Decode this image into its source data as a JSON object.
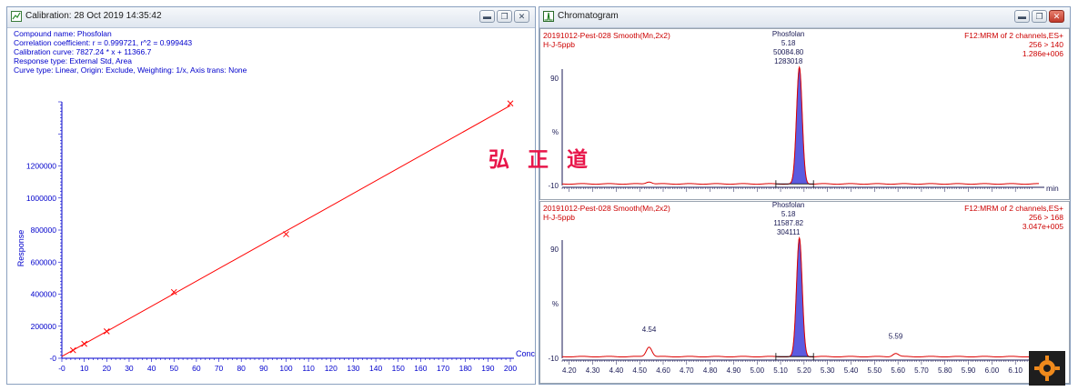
{
  "calibration_window": {
    "title": "Calibration: 28 Oct 2019 14:35:42",
    "info_lines": [
      "Compound name: Phosfolan",
      "Correlation coefficient: r = 0.999721, r^2 = 0.999443",
      "Calibration curve: 7827.24 * x + 11366.7",
      "Response type: External Std, Area",
      "Curve type: Linear, Origin: Exclude, Weighting: 1/x, Axis trans: None"
    ],
    "buttons": [
      "minimize",
      "restore",
      "close"
    ],
    "chart_data": {
      "type": "scatter",
      "xlabel": "Conc",
      "ylabel": "Response",
      "xlim": [
        0,
        200
      ],
      "ylim": [
        0,
        1600000
      ],
      "x_ticks": [
        "-0",
        "10",
        "20",
        "30",
        "40",
        "50",
        "60",
        "70",
        "80",
        "90",
        "100",
        "110",
        "120",
        "130",
        "140",
        "150",
        "160",
        "170",
        "180",
        "190",
        "200"
      ],
      "y_ticks": [
        "-0",
        "200000",
        "400000",
        "600000",
        "800000",
        "1000000",
        "1200000"
      ],
      "points": [
        {
          "x": 5,
          "y": 50000
        },
        {
          "x": 10,
          "y": 90000
        },
        {
          "x": 20,
          "y": 168000
        },
        {
          "x": 50,
          "y": 413000
        },
        {
          "x": 100,
          "y": 774000
        },
        {
          "x": 200,
          "y": 1590000
        }
      ],
      "fit_line": {
        "slope": 7827.24,
        "intercept": 11366.7,
        "x_range": [
          0,
          200
        ]
      },
      "colors": {
        "line": "#ff0000",
        "axis": "#0000cc",
        "text": "#0000cc"
      }
    }
  },
  "chromatogram_window": {
    "title": "Chromatogram",
    "buttons": [
      "minimize",
      "restore",
      "close"
    ],
    "x_axis_unit": "min",
    "x_ticks": [
      "4.20",
      "4.30",
      "4.40",
      "4.50",
      "4.60",
      "4.70",
      "4.80",
      "4.90",
      "5.00",
      "5.10",
      "5.20",
      "5.30",
      "5.40",
      "5.50",
      "5.60",
      "5.70",
      "5.80",
      "5.90",
      "6.00",
      "6.10"
    ],
    "xlim": [
      4.17,
      6.2
    ],
    "panels": [
      {
        "sample": "20191012-Pest-028 Smooth(Mn,2x2)",
        "sample_name": "H-J-5ppb",
        "function": "F12:MRM of 2 channels,ES+",
        "transition": "256 > 140",
        "intensity": "1.286e+006",
        "y_ticks": [
          "90",
          "%",
          "-10"
        ],
        "peak_labels": [
          "Phosfolan",
          "5.18",
          "50084.80",
          "1283018"
        ],
        "minor_peak_labels": [],
        "chart_data": {
          "type": "line",
          "main_peak": {
            "rt": 5.18,
            "height_pct": 100
          },
          "minor_peaks": [
            {
              "rt": 4.54,
              "height_pct": 2
            }
          ],
          "integration_window": [
            5.08,
            5.24
          ]
        }
      },
      {
        "sample": "20191012-Pest-028 Smooth(Mn,2x2)",
        "sample_name": "H-J-5ppb",
        "function": "F12:MRM of 2 channels,ES+",
        "transition": "256 > 168",
        "intensity": "3.047e+005",
        "y_ticks": [
          "90",
          "%",
          "-10"
        ],
        "peak_labels": [
          "Phosfolan",
          "5.18",
          "11587.82",
          "304111"
        ],
        "minor_peak_labels": [
          "4.54",
          "5.59"
        ],
        "chart_data": {
          "type": "line",
          "main_peak": {
            "rt": 5.18,
            "height_pct": 100
          },
          "minor_peaks": [
            {
              "rt": 4.54,
              "height_pct": 9
            },
            {
              "rt": 5.59,
              "height_pct": 3
            }
          ],
          "integration_window": [
            5.08,
            5.24
          ]
        }
      }
    ]
  },
  "watermark": "弘 正 道"
}
